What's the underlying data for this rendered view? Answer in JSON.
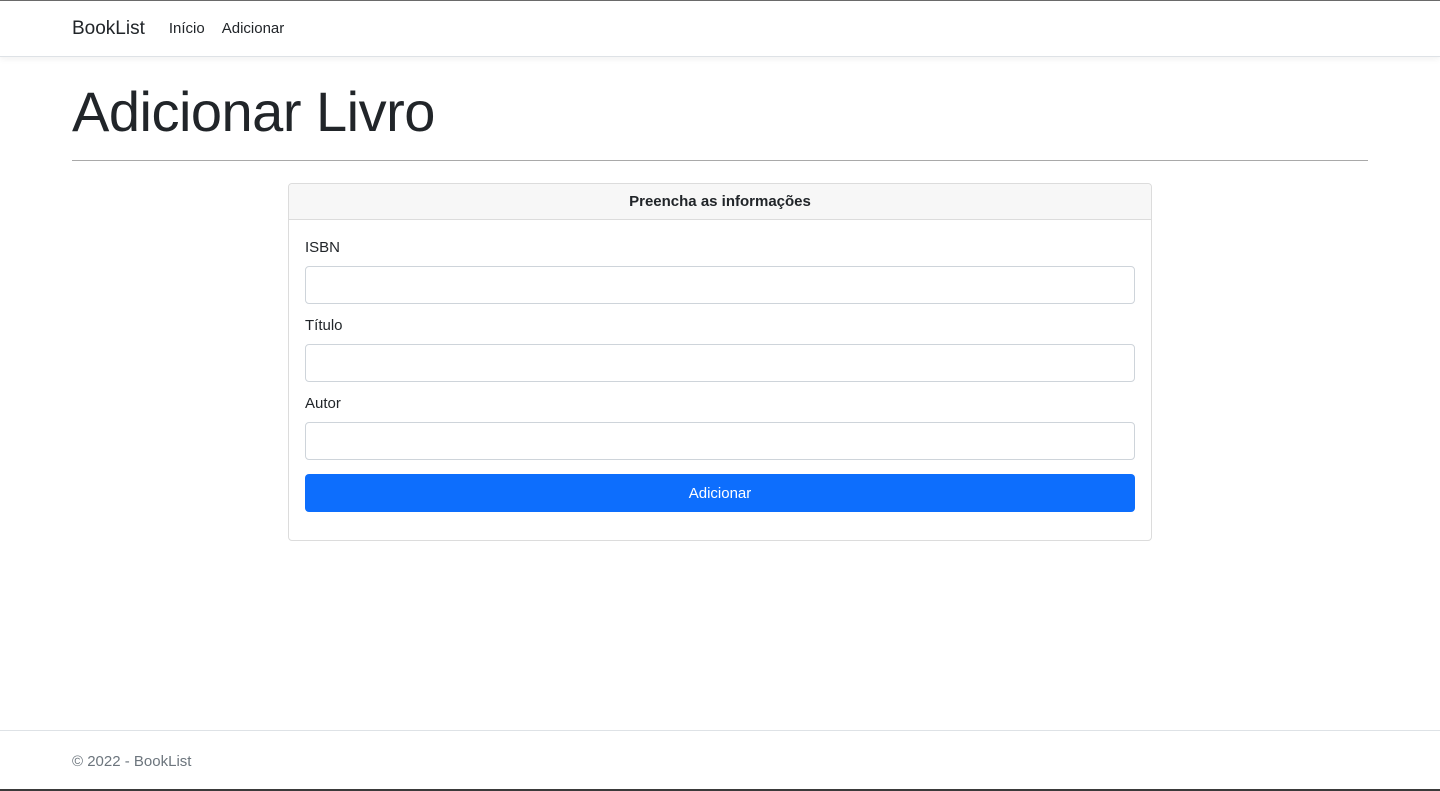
{
  "navbar": {
    "brand": "BookList",
    "links": [
      {
        "label": "Início"
      },
      {
        "label": "Adicionar"
      }
    ]
  },
  "page": {
    "title": "Adicionar Livro"
  },
  "form_card": {
    "header": "Preencha as informações",
    "fields": [
      {
        "label": "ISBN",
        "value": "",
        "placeholder": ""
      },
      {
        "label": "Título",
        "value": "",
        "placeholder": ""
      },
      {
        "label": "Autor",
        "value": "",
        "placeholder": ""
      }
    ],
    "submit_label": "Adicionar"
  },
  "footer": {
    "text": "© 2022 - BookList"
  },
  "colors": {
    "primary": "#0d6efd",
    "text": "#212529",
    "muted": "#6c757d",
    "card_header_bg": "#f7f7f7"
  }
}
